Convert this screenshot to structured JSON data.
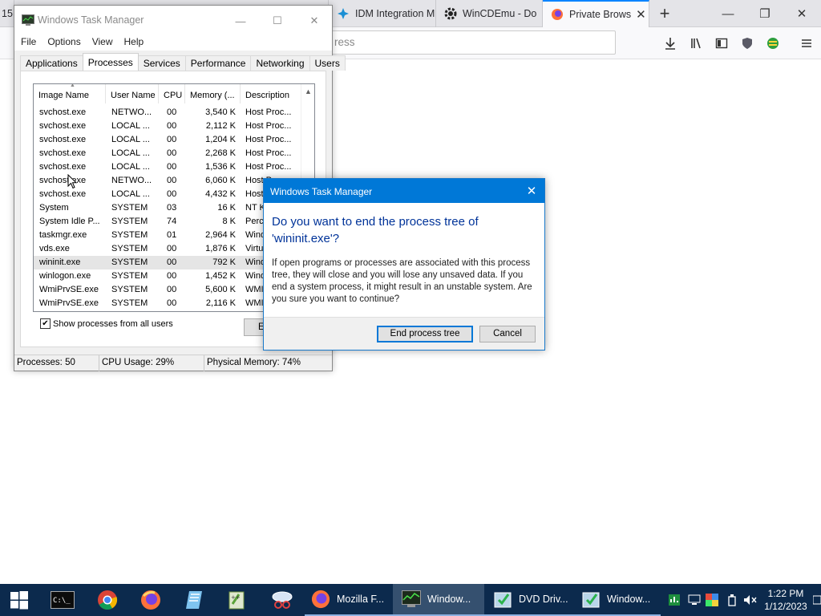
{
  "browser": {
    "tabs": [
      {
        "label": "15",
        "icon": "partial-tab-icon"
      },
      {
        "label": "",
        "icon": "folder-icon"
      },
      {
        "label": "IDM Integration M",
        "icon": "idm-icon"
      },
      {
        "label": "WinCDEmu - Do",
        "icon": "gear-icon"
      },
      {
        "label": "Private Brows",
        "icon": "firefox-icon",
        "active": true
      }
    ],
    "url_fragment": "ress"
  },
  "task_manager": {
    "title": "Windows Task Manager",
    "menu": [
      "File",
      "Options",
      "View",
      "Help"
    ],
    "tabs": [
      "Applications",
      "Processes",
      "Services",
      "Performance",
      "Networking",
      "Users"
    ],
    "active_tab": "Processes",
    "columns": [
      "Image Name",
      "User Name",
      "CPU",
      "Memory (...",
      "Description"
    ],
    "rows": [
      {
        "name": "svchost.exe",
        "user": "NETWO...",
        "cpu": "00",
        "mem": "3,540 K",
        "desc": "Host Proc..."
      },
      {
        "name": "svchost.exe",
        "user": "LOCAL ...",
        "cpu": "00",
        "mem": "2,112 K",
        "desc": "Host Proc..."
      },
      {
        "name": "svchost.exe",
        "user": "LOCAL ...",
        "cpu": "00",
        "mem": "1,204 K",
        "desc": "Host Proc..."
      },
      {
        "name": "svchost.exe",
        "user": "LOCAL ...",
        "cpu": "00",
        "mem": "2,268 K",
        "desc": "Host Proc..."
      },
      {
        "name": "svchost.exe",
        "user": "LOCAL ...",
        "cpu": "00",
        "mem": "1,536 K",
        "desc": "Host Proc..."
      },
      {
        "name": "svchost.exe",
        "user": "NETWO...",
        "cpu": "00",
        "mem": "6,060 K",
        "desc": "Host Proc..."
      },
      {
        "name": "svchost.exe",
        "user": "LOCAL ...",
        "cpu": "00",
        "mem": "4,432 K",
        "desc": "Host"
      },
      {
        "name": "System",
        "user": "SYSTEM",
        "cpu": "03",
        "mem": "16 K",
        "desc": "NT K"
      },
      {
        "name": "System Idle P...",
        "user": "SYSTEM",
        "cpu": "74",
        "mem": "8 K",
        "desc": "Perc"
      },
      {
        "name": "taskmgr.exe",
        "user": "SYSTEM",
        "cpu": "01",
        "mem": "2,964 K",
        "desc": "Wind"
      },
      {
        "name": "vds.exe",
        "user": "SYSTEM",
        "cpu": "00",
        "mem": "1,876 K",
        "desc": "Virtu"
      },
      {
        "name": "wininit.exe",
        "user": "SYSTEM",
        "cpu": "00",
        "mem": "792 K",
        "desc": "Wind",
        "selected": true
      },
      {
        "name": "winlogon.exe",
        "user": "SYSTEM",
        "cpu": "00",
        "mem": "1,452 K",
        "desc": "Wind"
      },
      {
        "name": "WmiPrvSE.exe",
        "user": "SYSTEM",
        "cpu": "00",
        "mem": "5,600 K",
        "desc": "WMI"
      },
      {
        "name": "WmiPrvSE.exe",
        "user": "SYSTEM",
        "cpu": "00",
        "mem": "2,116 K",
        "desc": "WMI"
      }
    ],
    "show_all_label": "Show processes from all users",
    "show_all_checked": true,
    "end_button_label": "End",
    "status": {
      "processes": "Processes: 50",
      "cpu": "CPU Usage: 29%",
      "memory": "Physical Memory: 74%"
    }
  },
  "dialog": {
    "title": "Windows Task Manager",
    "heading": "Do you want to end the process tree of 'wininit.exe'?",
    "body": "If open programs or processes are associated with this process tree, they will close and you will lose any unsaved data. If you end a system process, it might result in an unstable system. Are you sure you want to continue?",
    "confirm_label": "End process tree",
    "cancel_label": "Cancel"
  },
  "taskbar": {
    "items": [
      {
        "label": "Mozilla F...",
        "icon": "firefox-icon"
      },
      {
        "label": "Window...",
        "icon": "task-manager-icon",
        "active": true
      },
      {
        "label": "DVD Driv...",
        "icon": "drive-icon"
      },
      {
        "label": "Window...",
        "icon": "task-manager-icon"
      }
    ],
    "time": "1:22 PM",
    "date": "1/12/2023"
  }
}
